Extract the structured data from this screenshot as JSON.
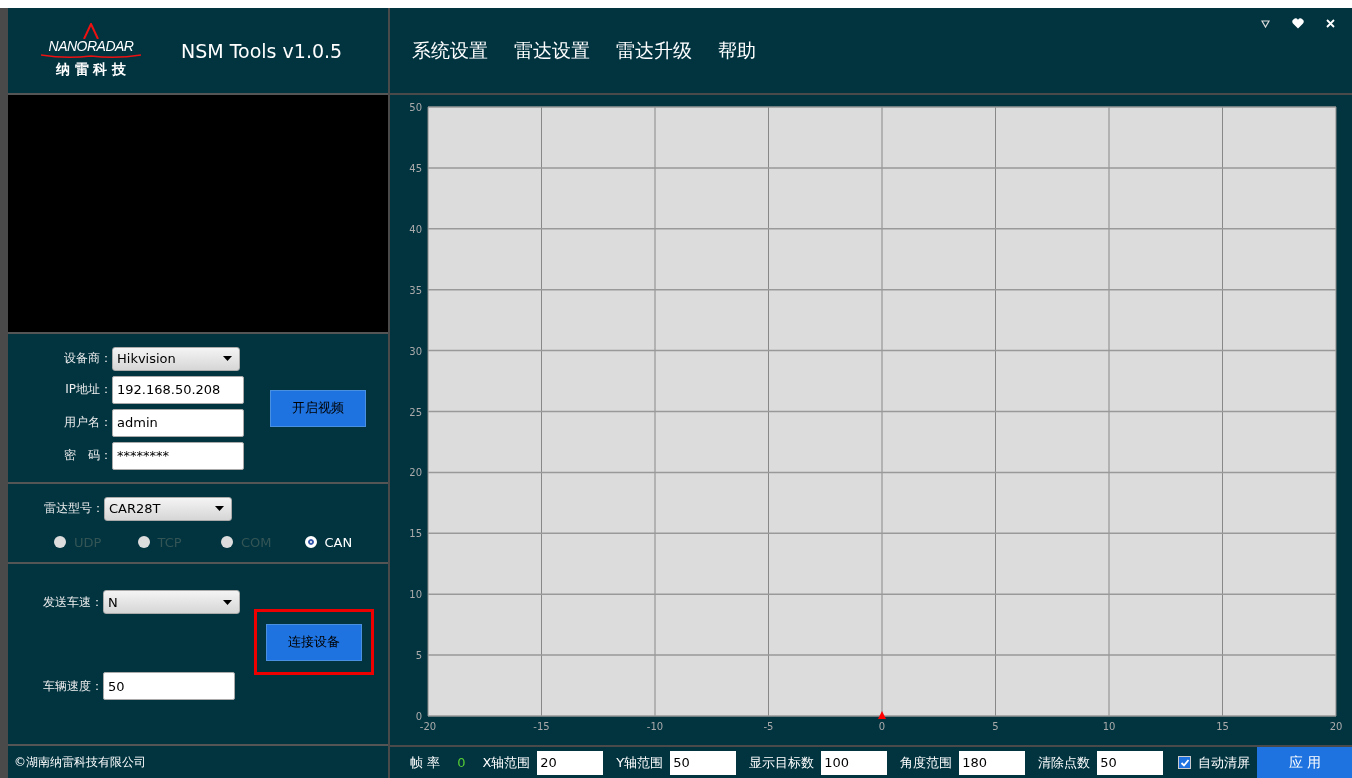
{
  "app": {
    "logo_text": "NANORADAR",
    "logo_subtitle": "纳 雷 科 技",
    "title": "NSM Tools v1.0.5"
  },
  "menu": [
    {
      "label": "系统设置"
    },
    {
      "label": "雷达设置"
    },
    {
      "label": "雷达升级"
    },
    {
      "label": "帮助"
    }
  ],
  "device": {
    "fields": [
      {
        "kind": "select",
        "label": "设备商：",
        "value": "Hikvision"
      },
      {
        "kind": "input",
        "label": "IP地址：",
        "value": "192.168.50.208"
      },
      {
        "kind": "input",
        "label": "用户名：",
        "value": "admin"
      },
      {
        "kind": "input",
        "label": "密　码：",
        "value": "********"
      }
    ],
    "button": "开启视频"
  },
  "radar": {
    "model_label": "雷达型号：",
    "model": "CAR28T",
    "protocols": [
      {
        "label": "UDP",
        "selected": false
      },
      {
        "label": "TCP",
        "selected": false
      },
      {
        "label": "COM",
        "selected": false
      },
      {
        "label": "CAN",
        "selected": true
      }
    ]
  },
  "speed": {
    "send_label": "发送车速：",
    "send": "N",
    "connect_button": "连接设备",
    "highlighted": true,
    "vehicle_label": "车辆速度：",
    "vehicle": "50"
  },
  "footer": "©湖南纳雷科技有限公司",
  "chart_data": {
    "type": "scatter",
    "xlim": [
      -20,
      20
    ],
    "ylim": [
      0,
      50
    ],
    "xticks": [
      -20,
      -15,
      -10,
      -5,
      0,
      5,
      10,
      15,
      20
    ],
    "yticks": [
      0,
      5,
      10,
      15,
      20,
      25,
      30,
      35,
      40,
      45,
      50
    ],
    "x": [
      0
    ],
    "grid": true,
    "series": [
      {
        "color": "#ff0000",
        "values": [
          0
        ]
      }
    ]
  },
  "status_bar": {
    "frame_rate_label": "帧 率",
    "frame_rate": "0",
    "settings": [
      {
        "label": "X轴范围",
        "value": "20"
      },
      {
        "label": "Y轴范围",
        "value": "50"
      },
      {
        "label": "显示目标数",
        "value": "100"
      },
      {
        "label": "角度范围",
        "value": "180"
      },
      {
        "label": "清除点数",
        "value": "50"
      }
    ],
    "auto_clear": {
      "label": "自动清屏",
      "checked": true
    },
    "apply_button": "应 用"
  }
}
